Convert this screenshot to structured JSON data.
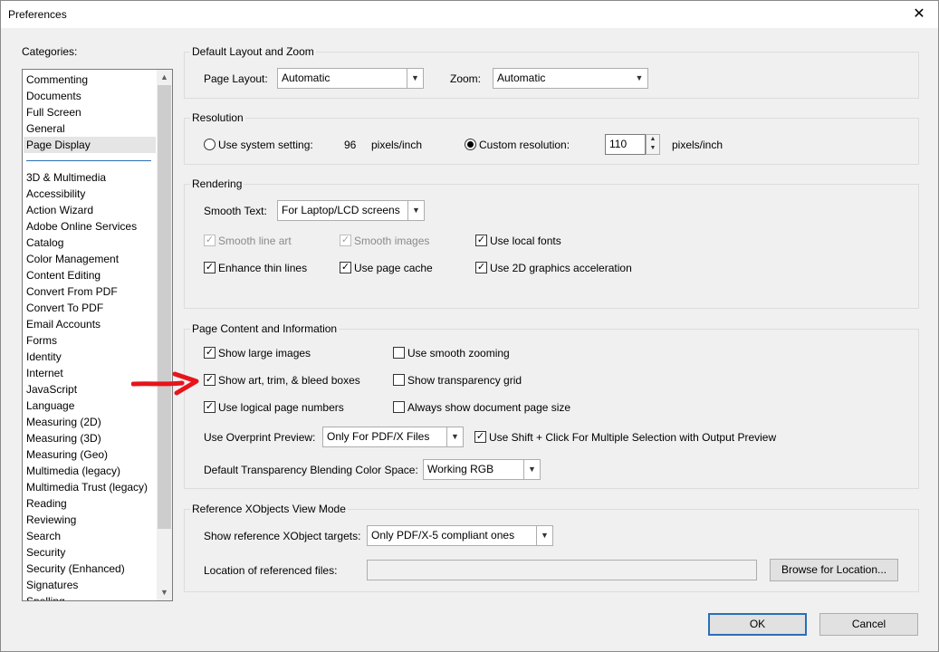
{
  "window": {
    "title": "Preferences",
    "close_glyph": "✕"
  },
  "categories": {
    "label": "Categories:",
    "top_items": [
      "Commenting",
      "Documents",
      "Full Screen",
      "General",
      "Page Display"
    ],
    "selected": "Page Display",
    "items": [
      "3D & Multimedia",
      "Accessibility",
      "Action Wizard",
      "Adobe Online Services",
      "Catalog",
      "Color Management",
      "Content Editing",
      "Convert From PDF",
      "Convert To PDF",
      "Email Accounts",
      "Forms",
      "Identity",
      "Internet",
      "JavaScript",
      "Language",
      "Measuring (2D)",
      "Measuring (3D)",
      "Measuring (Geo)",
      "Multimedia (legacy)",
      "Multimedia Trust (legacy)",
      "Reading",
      "Reviewing",
      "Search",
      "Security",
      "Security (Enhanced)",
      "Signatures",
      "Spelling"
    ]
  },
  "layout_zoom": {
    "title": "Default Layout and Zoom",
    "page_layout_label": "Page Layout:",
    "page_layout_value": "Automatic",
    "zoom_label": "Zoom:",
    "zoom_value": "Automatic"
  },
  "resolution": {
    "title": "Resolution",
    "system_label": "Use system setting:",
    "system_value": "96",
    "system_unit": "pixels/inch",
    "custom_label": "Custom resolution:",
    "custom_value": "110",
    "custom_unit": "pixels/inch",
    "selected": "custom"
  },
  "rendering": {
    "title": "Rendering",
    "smooth_text_label": "Smooth Text:",
    "smooth_text_value": "For Laptop/LCD screens",
    "smooth_line_art": "Smooth line art",
    "smooth_images": "Smooth images",
    "use_local_fonts": "Use local fonts",
    "enhance_thin_lines": "Enhance thin lines",
    "use_page_cache": "Use page cache",
    "use_2d_accel": "Use 2D graphics acceleration"
  },
  "page_content": {
    "title": "Page Content and Information",
    "show_large_images": "Show large images",
    "use_smooth_zooming": "Use smooth zooming",
    "show_art_trim_bleed": "Show art, trim, & bleed boxes",
    "show_transparency_grid": "Show transparency grid",
    "use_logical_page_numbers": "Use logical page numbers",
    "always_show_page_size": "Always show document page size",
    "overprint_label": "Use Overprint Preview:",
    "overprint_value": "Only For PDF/X Files",
    "shift_click_label": "Use Shift + Click For Multiple Selection with Output Preview",
    "blending_label": "Default Transparency Blending Color Space:",
    "blending_value": "Working RGB"
  },
  "xobjects": {
    "title": "Reference XObjects View Mode",
    "targets_label": "Show reference XObject targets:",
    "targets_value": "Only PDF/X-5 compliant ones",
    "location_label": "Location of referenced files:",
    "location_value": "",
    "browse_label": "Browse for Location..."
  },
  "footer": {
    "ok_label": "OK",
    "cancel_label": "Cancel"
  },
  "check_glyph": "✓",
  "colors": {
    "accent": "#2b6fb8",
    "arrow_annotation": "#e8141b"
  }
}
